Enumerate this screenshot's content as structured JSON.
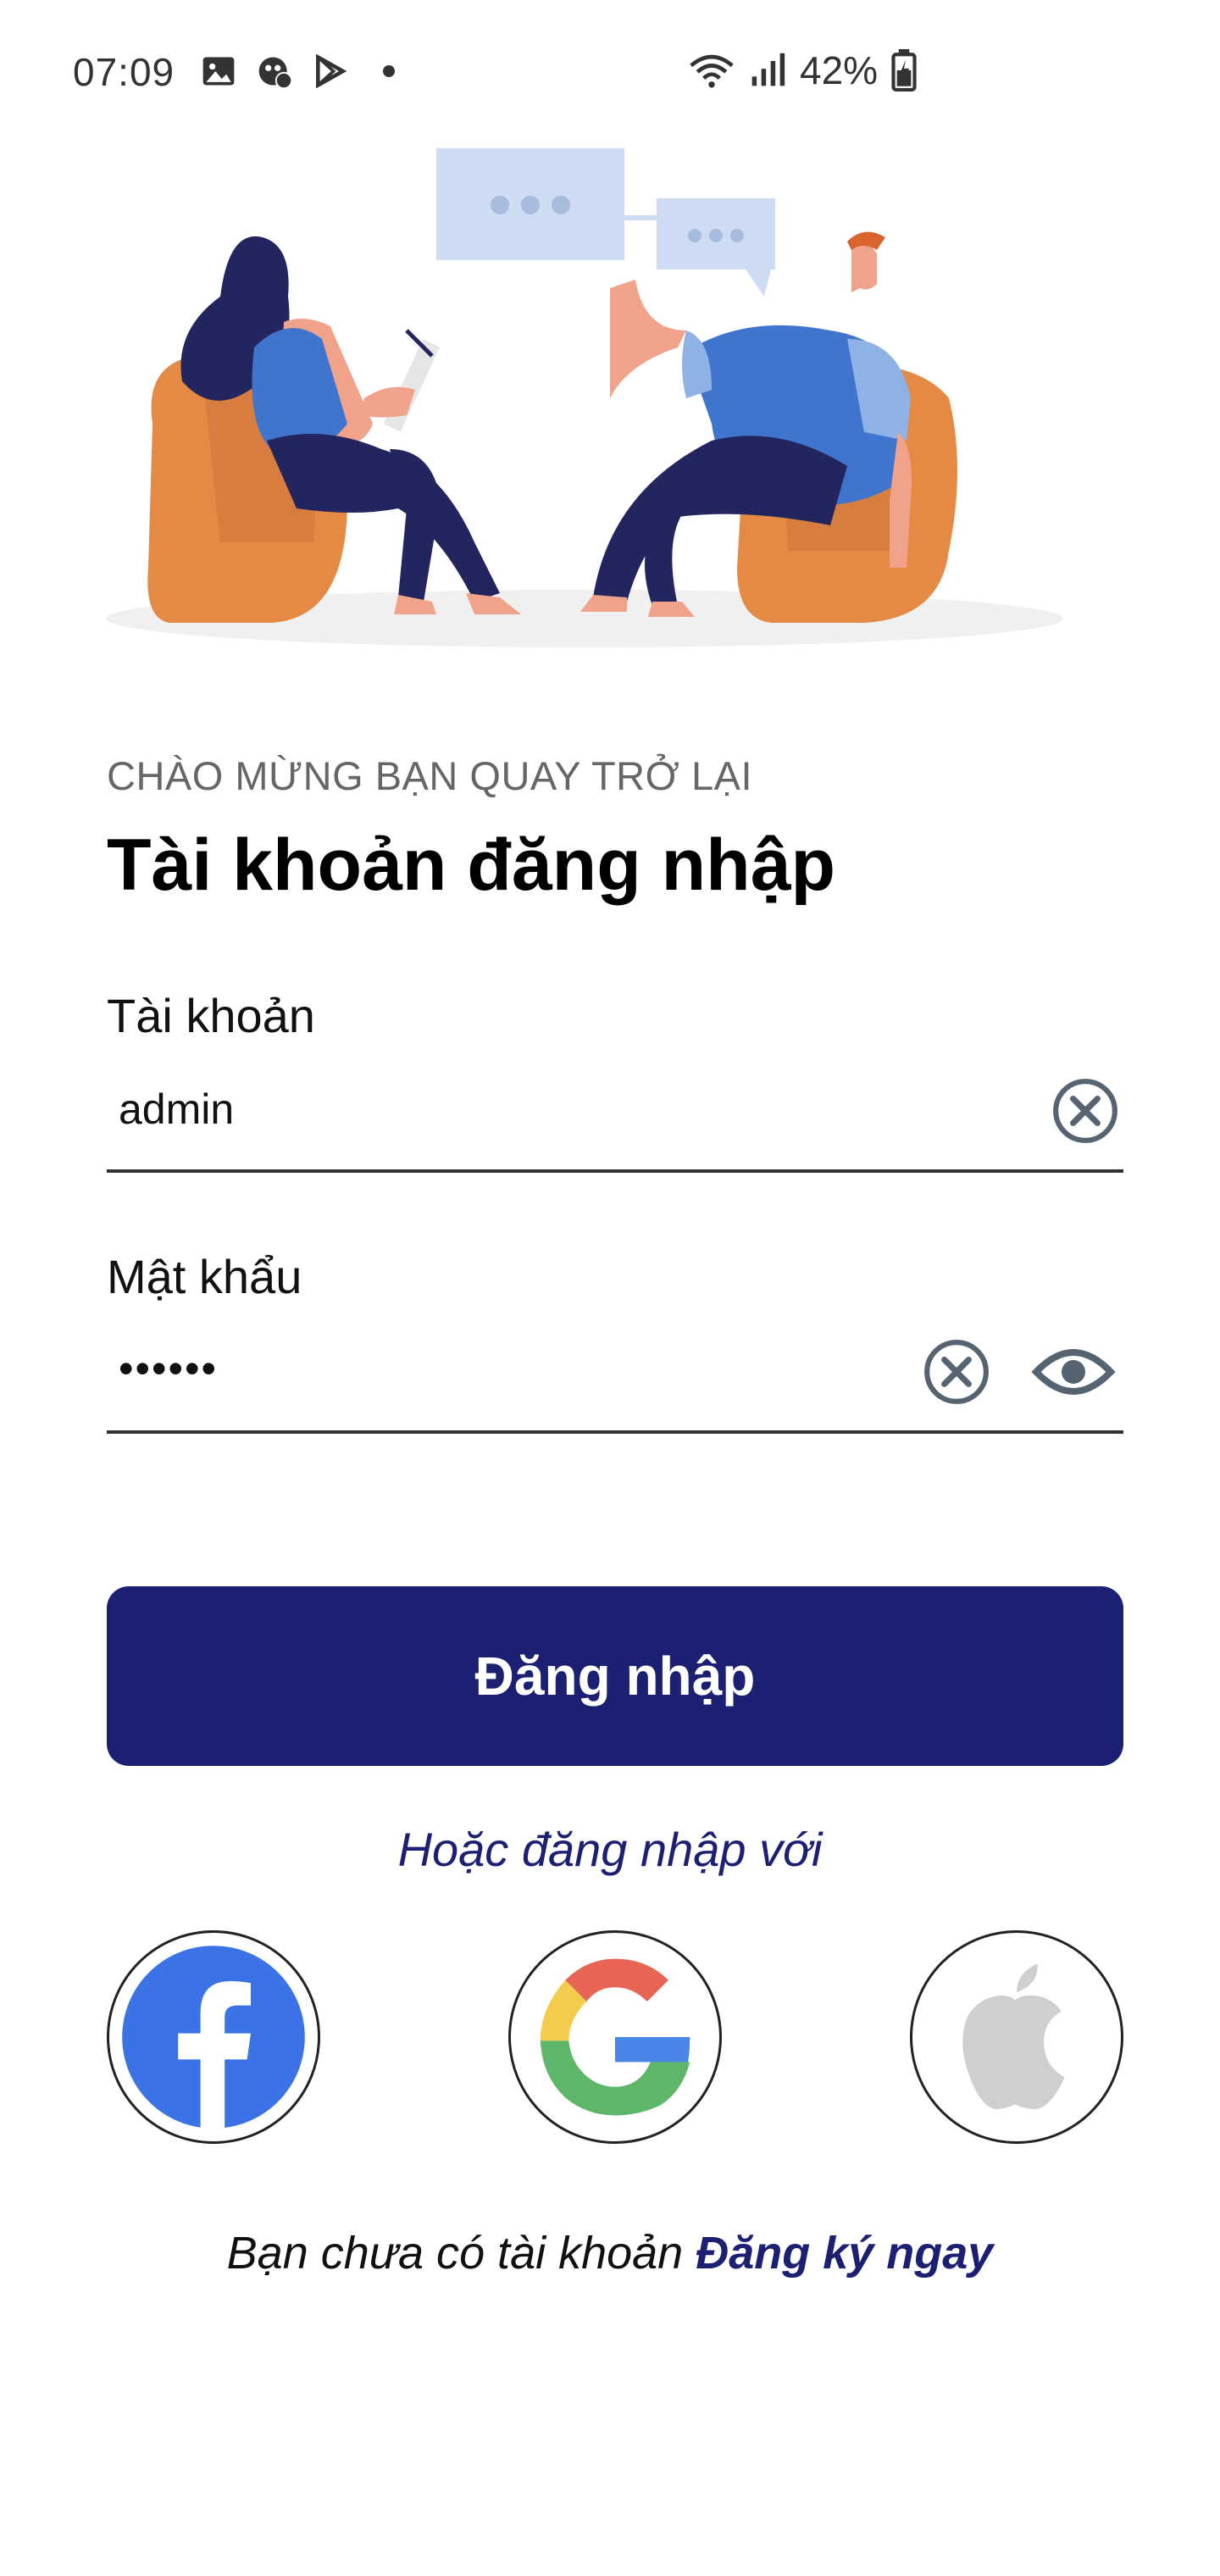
{
  "status_bar": {
    "time": "07:09",
    "battery": "42%",
    "icons_left": [
      "image-icon",
      "app-icon",
      "play-store-icon",
      "dot-icon"
    ],
    "icons_right": [
      "wifi-icon",
      "signal-icon",
      "battery-icon"
    ]
  },
  "header": {
    "welcome": "CHÀO MỪNG BẠN QUAY TRỞ LẠI",
    "title": "Tài khoản đăng nhập"
  },
  "form": {
    "username": {
      "label": "Tài khoản",
      "value": "admin"
    },
    "password": {
      "label": "Mật khẩu",
      "value": "••••••"
    }
  },
  "login_button": "Đăng nhập",
  "or_text": "Hoặc đăng nhập với",
  "social": [
    "facebook-icon",
    "google-icon",
    "apple-icon"
  ],
  "signup": {
    "text": "Bạn chưa có tài khoản",
    "link": "Đăng ký ngay"
  },
  "colors": {
    "primary": "#1c2073",
    "orange": "#e58a45",
    "navy": "#23265e",
    "blue": "#3f74cf"
  }
}
